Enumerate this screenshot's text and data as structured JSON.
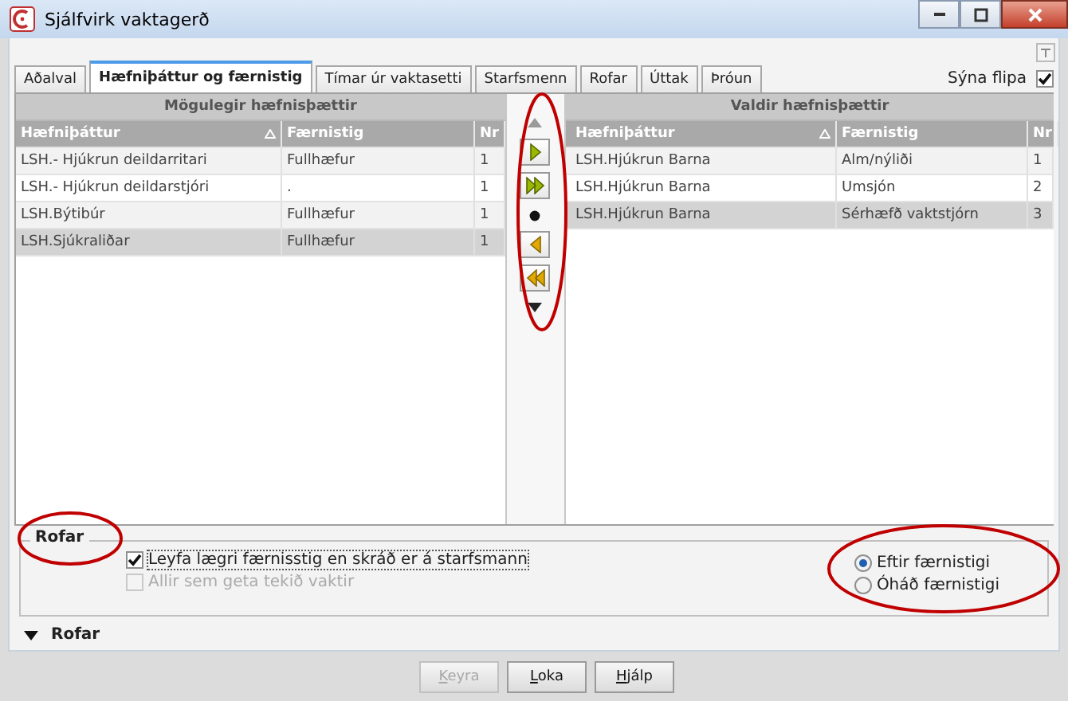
{
  "window": {
    "title": "Sjálfvirk vaktagerð"
  },
  "tabs": [
    {
      "label": "Aðalval",
      "selected": false
    },
    {
      "label": "Hæfniþáttur og færnistig",
      "selected": true
    },
    {
      "label": "Tímar úr vaktasetti",
      "selected": false
    },
    {
      "label": "Starfsmenn",
      "selected": false
    },
    {
      "label": "Rofar",
      "selected": false
    },
    {
      "label": "Úttak",
      "selected": false
    },
    {
      "label": "Þróun",
      "selected": false
    }
  ],
  "show_tabs": {
    "label": "Sýna flipa",
    "checked": true
  },
  "available": {
    "title": "Mögulegir hæfnisþættir",
    "columns": [
      {
        "label": "Hæfniþáttur",
        "sorted": true
      },
      {
        "label": "Færnistig",
        "sorted": false
      },
      {
        "label": "Nr",
        "sorted": false
      }
    ],
    "rows": [
      {
        "cells": [
          "LSH.- Hjúkrun deildarritari",
          "Fullhæfur",
          "1"
        ],
        "selected": false
      },
      {
        "cells": [
          "LSH.- Hjúkrun deildarstjóri",
          ".",
          "1"
        ],
        "selected": false
      },
      {
        "cells": [
          "LSH.Býtibúr",
          "Fullhæfur",
          "1"
        ],
        "selected": false
      },
      {
        "cells": [
          "LSH.Sjúkraliðar",
          "Fullhæfur",
          "1"
        ],
        "selected": true
      }
    ]
  },
  "transfer_buttons": [
    {
      "kind": "up"
    },
    {
      "kind": "add"
    },
    {
      "kind": "add_all"
    },
    {
      "kind": "dot"
    },
    {
      "kind": "remove"
    },
    {
      "kind": "remove_all"
    },
    {
      "kind": "down"
    }
  ],
  "chosen": {
    "title": "Valdir hæfnisþættir",
    "columns": [
      {
        "label": "Hæfniþáttur",
        "sorted": true
      },
      {
        "label": "Færnistig",
        "sorted": false
      },
      {
        "label": "Nr",
        "sorted": false
      }
    ],
    "rows": [
      {
        "cells": [
          "LSH.Hjúkrun Barna",
          "Alm/nýliði",
          "1"
        ],
        "selected": false
      },
      {
        "cells": [
          "LSH.Hjúkrun Barna",
          "Umsjón",
          "2"
        ],
        "selected": false
      },
      {
        "cells": [
          "LSH.Hjúkrun Barna",
          "Sérhæfð vaktstjórn",
          "3"
        ],
        "selected": true
      }
    ]
  },
  "options": {
    "title": "Rofar",
    "checkboxes": [
      {
        "label": "Leyfa lægri færnisstig en skráð er á starfsmann",
        "checked": true,
        "disabled": false
      },
      {
        "label": "Allir sem geta tekið vaktir",
        "checked": false,
        "disabled": true
      }
    ],
    "radios": [
      {
        "label": "Eftir færnistigi",
        "selected": true
      },
      {
        "label": "Óháð færnistigi",
        "selected": false
      }
    ]
  },
  "collapsed_section": {
    "label": "Rofar",
    "expanded": false
  },
  "buttons": [
    {
      "label": "Keyra",
      "disabled": true
    },
    {
      "label": "Loka",
      "disabled": false
    },
    {
      "label": "Hjálp",
      "disabled": false
    }
  ]
}
